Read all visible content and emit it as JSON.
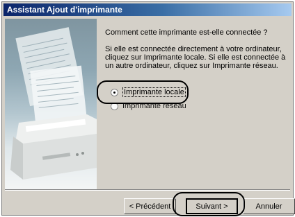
{
  "window": {
    "title": "Assistant Ajout d'imprimante"
  },
  "content": {
    "question": "Comment cette imprimante est-elle connectée ?",
    "explanation": "Si elle est connectée directement à votre ordinateur, cliquez sur Imprimante locale. Si elle est connectée à un autre ordinateur, cliquez sur Imprimante réseau.",
    "options": [
      {
        "label": "Imprimante locale",
        "selected": true
      },
      {
        "label": "Imprimante réseau",
        "selected": false
      }
    ]
  },
  "buttons": {
    "back": "< Précédent",
    "next": "Suivant >",
    "cancel": "Annuler"
  },
  "colors": {
    "dialog_face": "#d4d0c8",
    "title_start": "#0a246a",
    "title_end": "#a6caf0",
    "highlight": "#000000"
  }
}
